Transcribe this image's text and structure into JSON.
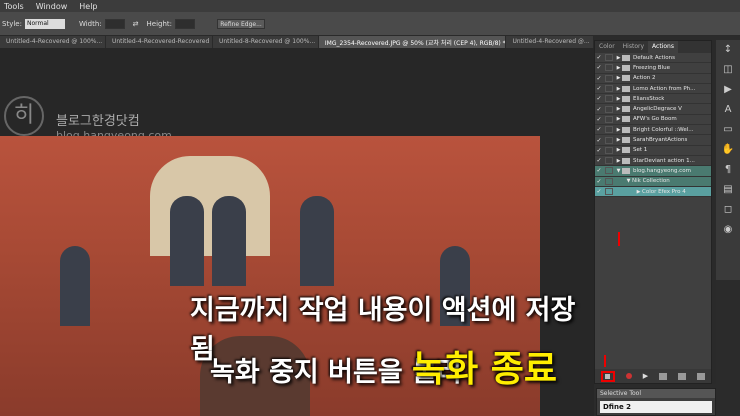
{
  "menubar": {
    "items": [
      "Tools",
      "Window",
      "Help"
    ]
  },
  "options": {
    "style_label": "Style:",
    "style_value": "Normal",
    "width_label": "Width:",
    "height_label": "Height:",
    "refine": "Refine Edge..."
  },
  "tabs": [
    "Untitled-4-Recovered @ 100%...",
    "Untitled-4-Recovered-Recovered",
    "Untitled-8-Recovered @ 100%...",
    "IMG_2354-Recovered.JPG @ 50% (교차 처리 (CEP 4), RGB/8) *",
    "Untitled-4-Recovered @..."
  ],
  "logo": {
    "glyph": "히",
    "name": "블로그한경닷컴",
    "url": "blog.hangyeong.com"
  },
  "overlay": {
    "line1": "지금까지 작업 내용이 액션에 저장 됨",
    "line2": "녹화 중지 버튼을 눌러",
    "line3": "녹화 종료"
  },
  "panel": {
    "tabs": [
      "Color",
      "History",
      "Actions"
    ],
    "actions": [
      {
        "check": "✓",
        "label": "Default Actions",
        "arrow": "▶"
      },
      {
        "check": "✓",
        "label": "Freezing Blue",
        "arrow": "▶"
      },
      {
        "check": "✓",
        "label": "Action 2",
        "arrow": "▶"
      },
      {
        "check": "✓",
        "label": "Lomo Action from Ph...",
        "arrow": "▶"
      },
      {
        "check": "✓",
        "label": "EliansStock",
        "arrow": "▶"
      },
      {
        "check": "✓",
        "label": "AngelicDegrace V",
        "arrow": "▶"
      },
      {
        "check": "✓",
        "label": "AFW's Go Boom",
        "arrow": "▶"
      },
      {
        "check": "✓",
        "label": "Bright Colorful ::Wel...",
        "arrow": "▶"
      },
      {
        "check": "✓",
        "label": "SarahBryantActions",
        "arrow": "▶"
      },
      {
        "check": "✓",
        "label": "Set 1",
        "arrow": "▶"
      },
      {
        "check": "✓",
        "label": "StarDeviant action 1...",
        "arrow": "▶"
      },
      {
        "check": "✓",
        "label": "blog.hangyeong.com",
        "arrow": "▼"
      },
      {
        "check": "✓",
        "label": "Nik Collection",
        "arrow": "▼"
      },
      {
        "check": "✓",
        "label": "Color Efex Pro 4",
        "arrow": "▶"
      }
    ]
  },
  "tools": [
    "↕",
    "◫",
    "▶",
    "A",
    "▭",
    "✋",
    "¶",
    "▤",
    "◻",
    "◉"
  ],
  "selective_tool": {
    "title": "Selective Tool",
    "value": "Dfine 2"
  }
}
